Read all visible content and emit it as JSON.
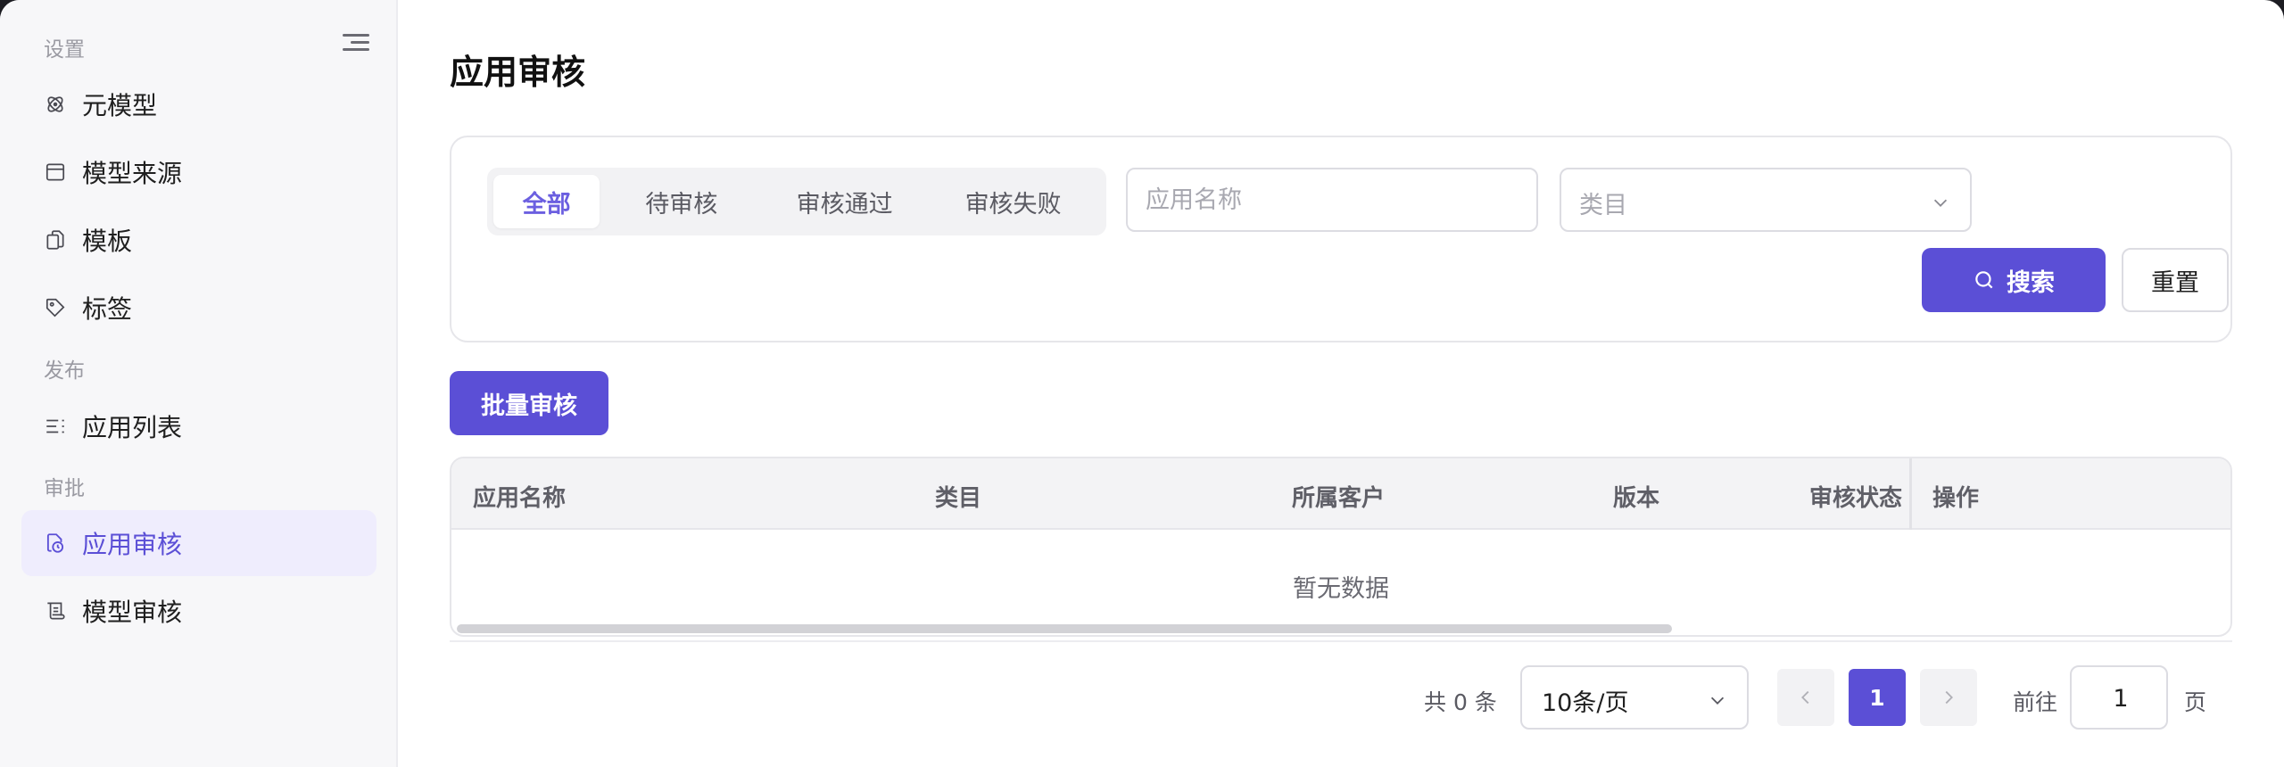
{
  "sidebar": {
    "sections": [
      {
        "label": "设置",
        "items": [
          {
            "label": "元模型",
            "icon": "atom-icon"
          },
          {
            "label": "模型来源",
            "icon": "window-icon"
          },
          {
            "label": "模板",
            "icon": "copy-icon"
          },
          {
            "label": "标签",
            "icon": "tag-icon"
          }
        ]
      },
      {
        "label": "发布",
        "items": [
          {
            "label": "应用列表",
            "icon": "list-icon"
          }
        ]
      },
      {
        "label": "审批",
        "items": [
          {
            "label": "应用审核",
            "icon": "file-clock-icon",
            "active": true
          },
          {
            "label": "模型审核",
            "icon": "scroll-icon"
          }
        ]
      }
    ]
  },
  "page": {
    "title": "应用审核"
  },
  "filters": {
    "tabs": [
      {
        "label": "全部",
        "active": true
      },
      {
        "label": "待审核"
      },
      {
        "label": "审核通过"
      },
      {
        "label": "审核失败"
      }
    ],
    "app_name_placeholder": "应用名称",
    "category_placeholder": "类目",
    "search_label": "搜索",
    "reset_label": "重置"
  },
  "actions": {
    "batch_review_label": "批量审核"
  },
  "table": {
    "columns": [
      "应用名称",
      "类目",
      "所属客户",
      "版本",
      "审核状态",
      "操作"
    ],
    "rows": [],
    "empty_text": "暂无数据"
  },
  "pagination": {
    "total_text": "共 0 条",
    "page_size": "10条/页",
    "current_page": "1",
    "goto_prefix": "前往",
    "goto_value": "1",
    "goto_suffix": "页"
  },
  "colors": {
    "accent": "#5b4fd6",
    "active_bg": "#efedfd"
  }
}
